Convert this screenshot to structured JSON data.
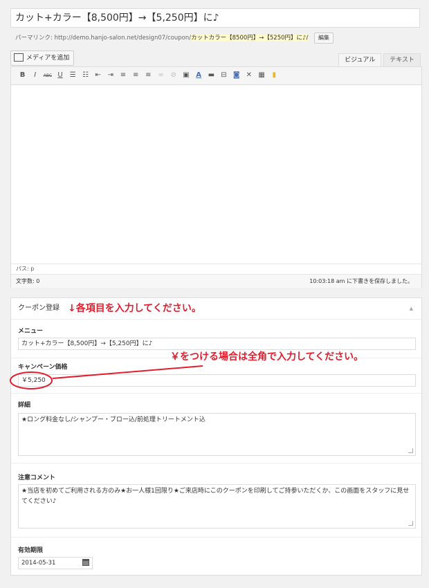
{
  "post": {
    "title": "カット+カラー【8,500円】→【5,250円】に♪",
    "permalink_label": "パーマリンク:",
    "permalink_url": "http://demo.hanjo-salon.net/design07/coupon/",
    "permalink_slug": "カットカラー【8500円】→【5250円】に♪/",
    "edit_label": "編集"
  },
  "editor": {
    "media_button": "メディアを追加",
    "tabs": [
      "ビジュアル",
      "テキスト"
    ],
    "path": "パス: p",
    "word_count": "文字数: 0",
    "saved_status": "10:03:18 am に下書きを保存しました。"
  },
  "toolbar_icons": [
    "bold-icon",
    "italic-icon",
    "strikethrough-icon",
    "underline-icon",
    "bullet-list-icon",
    "numbered-list-icon",
    "outdent-icon",
    "indent-icon",
    "align-left-icon",
    "align-center-icon",
    "align-right-icon",
    "link-icon",
    "unlink-icon",
    "insert-media-icon",
    "text-color-icon",
    "horizontal-rule-icon",
    "page-break-icon",
    "find-replace-icon",
    "fullscreen-icon",
    "toolbar-toggle-icon",
    "paint-icon"
  ],
  "coupon": {
    "panel_title": "クーポン登録",
    "annotation_1": "↓各項目を入力してください。",
    "annotation_2": "￥をつける場合は全角で入力してください。",
    "menu_label": "メニュー",
    "menu_value": "カット+カラー【8,500円】→【5,250円】に♪",
    "price_label": "キャンペーン価格",
    "price_value": "￥5,250",
    "detail_label": "詳細",
    "detail_value": "★ロング料金なし/シャンプー・ブロー込/前処理トリートメント込",
    "note_label": "注意コメント",
    "note_value": "★当店を初めてご利用される方のみ★お一人様1回限り★ご来店時にこのクーポンを印刷してご持参いただくか、この画面をスタッフに見せてください♪",
    "expiry_label": "有効期限",
    "expiry_value": "2014-05-31"
  },
  "colors": {
    "annotation": "#e21d2d",
    "slug_highlight": "#fffbcc"
  }
}
